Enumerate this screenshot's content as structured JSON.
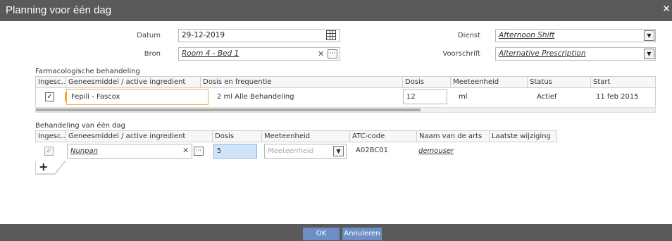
{
  "dialog": {
    "title": "Planning voor één dag"
  },
  "form": {
    "datum_label": "Datum",
    "datum_value": "29-12-2019",
    "bron_label": "Bron",
    "bron_value": "Room 4 - Bed 1",
    "dienst_label": "Dienst",
    "dienst_value": "Afternoon Shift",
    "voorschrift_label": "Voorschrift",
    "voorschrift_value": "Alternative Prescription"
  },
  "pharma": {
    "section_title": "Farmacologische behandeling",
    "columns": [
      "Ingesc...",
      "Geneesmiddel / active ingredient",
      "Dosis en frequentie",
      "Dosis",
      "Meeteenheid",
      "Status",
      "Start"
    ],
    "row": {
      "checked": "✓",
      "warning": "!",
      "drug": "Fepili - Fascox",
      "dose_freq": "2 ml Alle  Behandeling",
      "dose": "12",
      "unit": "ml",
      "status": "Actief",
      "start": "11 feb 2015"
    }
  },
  "oneday": {
    "section_title": "Behandeling van één dag",
    "columns": [
      "Ingesc...",
      "Geneesmiddel / active ingredient",
      "Dosis",
      "Meeteenheid",
      "ATC-code",
      "Naam van de arts",
      "Laatste wijziging"
    ],
    "row": {
      "checked": "✓",
      "drug": "Nunpan",
      "dose": "5",
      "unit_placeholder": "Meeteenheid",
      "atc": "A02BC01",
      "doctor": "demouser",
      "last_change": ""
    },
    "add_label": "+"
  },
  "footer": {
    "ok_label": "OK",
    "cancel_label": "Annuleren"
  },
  "colors": {
    "titlebar": "#5a5a5a",
    "button": "#6d8fc6",
    "highlight_field": "#cfe4f8",
    "focus_border": "#f0b042"
  }
}
